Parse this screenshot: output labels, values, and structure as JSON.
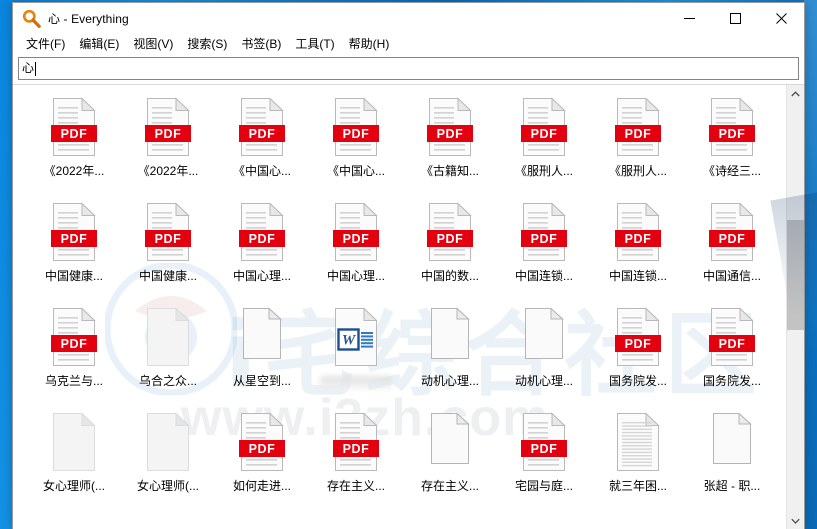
{
  "window": {
    "title": "心 - Everything",
    "app_icon": "magnifier-icon",
    "controls": {
      "minimize": "minimize-icon",
      "maximize": "maximize-icon",
      "close": "close-icon"
    }
  },
  "menubar": {
    "items": [
      {
        "label": "文件(F)"
      },
      {
        "label": "编辑(E)"
      },
      {
        "label": "视图(V)"
      },
      {
        "label": "搜索(S)"
      },
      {
        "label": "书签(B)"
      },
      {
        "label": "工具(T)"
      },
      {
        "label": "帮助(H)"
      }
    ]
  },
  "search": {
    "value": "心",
    "placeholder": ""
  },
  "watermark": {
    "site_cn": "i宅综合社区",
    "url": "www.i3zh.com",
    "logo": "hat-logo-icon"
  },
  "colors": {
    "pdf_red": "#e3000f",
    "word_blue": "#2b579a",
    "accent_blue": "#0078d7",
    "titlebar_bg": "#ffffff",
    "window_bg": "#ffffff"
  },
  "results": {
    "items": [
      {
        "label": "《2022年...",
        "icon": "pdf-file-icon"
      },
      {
        "label": "《2022年...",
        "icon": "pdf-file-icon"
      },
      {
        "label": "《中国心...",
        "icon": "pdf-file-icon"
      },
      {
        "label": "《中国心...",
        "icon": "pdf-file-icon"
      },
      {
        "label": "《古籍知...",
        "icon": "pdf-file-icon"
      },
      {
        "label": "《服刑人...",
        "icon": "pdf-file-icon"
      },
      {
        "label": "《服刑人...",
        "icon": "pdf-file-icon"
      },
      {
        "label": "《诗经三...",
        "icon": "pdf-file-icon"
      },
      {
        "label": "中国健康...",
        "icon": "pdf-file-icon"
      },
      {
        "label": "中国健康...",
        "icon": "pdf-file-icon"
      },
      {
        "label": "中国心理...",
        "icon": "pdf-file-icon"
      },
      {
        "label": "中国心理...",
        "icon": "pdf-file-icon"
      },
      {
        "label": "中国的数...",
        "icon": "pdf-file-icon"
      },
      {
        "label": "中国连锁...",
        "icon": "pdf-file-icon"
      },
      {
        "label": "中国连锁...",
        "icon": "pdf-file-icon"
      },
      {
        "label": "中国通信...",
        "icon": "pdf-file-icon"
      },
      {
        "label": "乌克兰与...",
        "icon": "pdf-file-icon"
      },
      {
        "label": "乌合之众...",
        "icon": "blank-document-icon"
      },
      {
        "label": "从星空到...",
        "icon": "plain-document-icon"
      },
      {
        "label": "",
        "icon": "word-file-icon",
        "redacted": true
      },
      {
        "label": "动机心理...",
        "icon": "plain-document-icon"
      },
      {
        "label": "动机心理...",
        "icon": "plain-document-icon"
      },
      {
        "label": "国务院发...",
        "icon": "pdf-file-icon"
      },
      {
        "label": "国务院发...",
        "icon": "pdf-file-icon"
      },
      {
        "label": "女心理师(...",
        "icon": "blank-document-icon"
      },
      {
        "label": "女心理师(...",
        "icon": "blank-document-icon"
      },
      {
        "label": "如何走进...",
        "icon": "pdf-file-icon"
      },
      {
        "label": "存在主义...",
        "icon": "pdf-file-icon"
      },
      {
        "label": "存在主义...",
        "icon": "plain-document-icon"
      },
      {
        "label": "宅园与庭...",
        "icon": "pdf-file-icon"
      },
      {
        "label": "就三年困...",
        "icon": "text-file-icon"
      },
      {
        "label": "张超 - 职...",
        "icon": "plain-document-icon"
      }
    ]
  },
  "scrollbar": {
    "up_arrow": "chevron-up-icon",
    "down_arrow": "chevron-down-icon"
  }
}
